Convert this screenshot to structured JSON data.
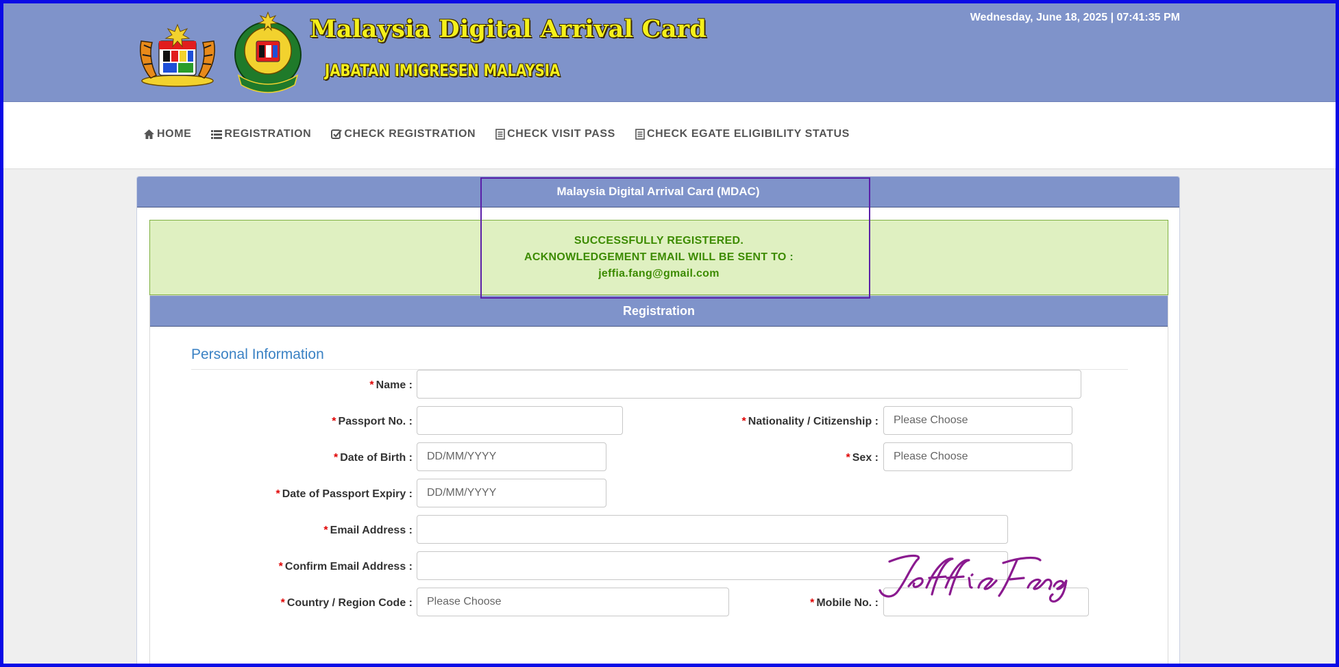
{
  "header": {
    "title": "Malaysia Digital Arrival Card",
    "subtitle": "JABATAN IMIGRESEN MALAYSIA",
    "datetime": "Wednesday, June 18, 2025 | 07:41:35 PM",
    "bg_color": "#7f93ca",
    "title_color": "#f5f01a"
  },
  "nav": {
    "items": [
      {
        "label": "HOME",
        "icon": "home-icon"
      },
      {
        "label": "REGISTRATION",
        "icon": "list-icon"
      },
      {
        "label": "CHECK REGISTRATION",
        "icon": "check-square-icon"
      },
      {
        "label": "CHECK VISIT PASS",
        "icon": "document-icon"
      },
      {
        "label": "CHECK EGATE ELIGIBILITY STATUS",
        "icon": "document-icon"
      }
    ]
  },
  "panel": {
    "title": "Malaysia Digital Arrival Card (MDAC)"
  },
  "alert": {
    "line1": "SUCCESSFULLY REGISTERED.",
    "line2": "ACKNOWLEDGEMENT EMAIL WILL BE SENT TO :",
    "email": "jeffia.fang@gmail.com",
    "color": "#3c8b00"
  },
  "registration": {
    "title": "Registration",
    "section_title": "Personal Information",
    "required_mark": "*",
    "fields": {
      "name": {
        "label": "Name :",
        "value": ""
      },
      "passport": {
        "label": "Passport No. :",
        "value": ""
      },
      "nationality": {
        "label": "Nationality / Citizenship :",
        "value": "Please Choose"
      },
      "dob": {
        "label": "Date of Birth :",
        "placeholder": "DD/MM/YYYY"
      },
      "sex": {
        "label": "Sex :",
        "value": "Please Choose"
      },
      "passport_expiry": {
        "label": "Date of Passport Expiry :",
        "placeholder": "DD/MM/YYYY"
      },
      "email": {
        "label": "Email Address :",
        "value": ""
      },
      "confirm_email": {
        "label": "Confirm Email Address :",
        "value": ""
      },
      "country_code": {
        "label": "Country / Region Code :",
        "value": "Please Choose"
      },
      "mobile": {
        "label": "Mobile No. :",
        "value": ""
      }
    }
  },
  "watermark": {
    "signature": "Jeffia Fang",
    "color": "#8a1a8f"
  }
}
